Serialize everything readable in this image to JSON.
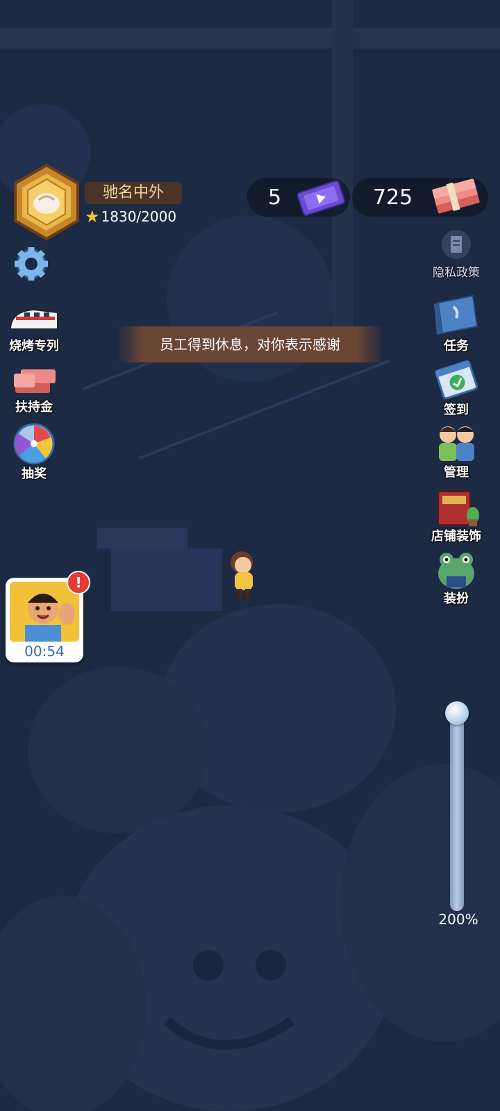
{
  "rank": {
    "title": "驰名中外",
    "progress": "1830/2000"
  },
  "currencies": {
    "tickets": "5",
    "money": "725"
  },
  "left_menu": [
    {
      "id": "settings",
      "label": ""
    },
    {
      "id": "bbq_train",
      "label": "烧烤专列"
    },
    {
      "id": "support_fund",
      "label": "扶持金"
    },
    {
      "id": "lottery",
      "label": "抽奖"
    }
  ],
  "right_menu": [
    {
      "id": "privacy",
      "label": "隐私政策"
    },
    {
      "id": "tasks",
      "label": "任务"
    },
    {
      "id": "checkin",
      "label": "签到"
    },
    {
      "id": "manage",
      "label": "管理"
    },
    {
      "id": "decor",
      "label": "店铺装饰"
    },
    {
      "id": "dressup",
      "label": "装扮"
    }
  ],
  "banner": {
    "message": "员工得到休息，对你表示感谢"
  },
  "timer": {
    "value": "00:54",
    "alert": "!"
  },
  "zoom": {
    "label": "200%",
    "level": 1.0
  },
  "colors": {
    "background": "#1d2a44",
    "banner": "#6b4634",
    "rank_box": "#4a3426"
  }
}
